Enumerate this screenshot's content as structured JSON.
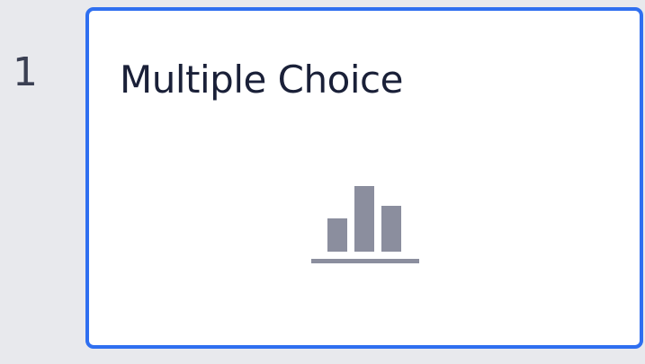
{
  "slide": {
    "number": "1",
    "title": "Multiple Choice",
    "icon": "bar-chart-icon",
    "selected": true
  },
  "colors": {
    "background": "#e8e9ed",
    "card": "#ffffff",
    "selected_border": "#2f6ff0",
    "title_text": "#1a2038",
    "number_text": "#3a3f52",
    "icon_fill": "#8b8e9e"
  }
}
